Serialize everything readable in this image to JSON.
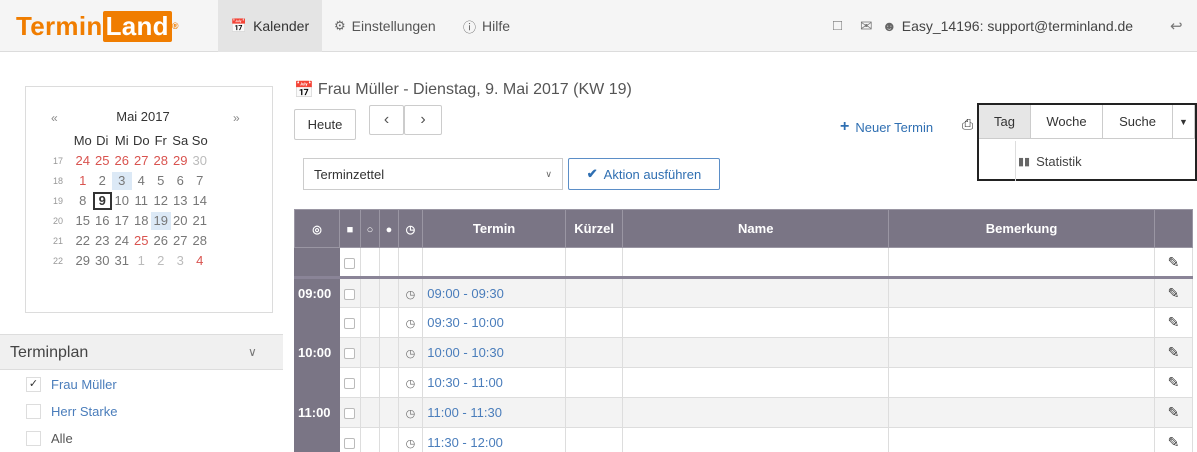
{
  "app": {
    "logo_text_a": "Termin",
    "logo_text_b": "Land",
    "logo_reg": "®"
  },
  "nav": {
    "kalender": "Kalender",
    "einstellungen": "Einstellungen",
    "hilfe": "Hilfe"
  },
  "user": {
    "account": "Easy_14196: support@terminland.de"
  },
  "mini_calendar": {
    "prev": "«",
    "next": "»",
    "month": "Mai 2017",
    "weekdays": [
      "Mo",
      "Di",
      "Mi",
      "Do",
      "Fr",
      "Sa",
      "So"
    ],
    "weeks": [
      {
        "kw": "17",
        "days": [
          "24",
          "25",
          "26",
          "27",
          "28",
          "29",
          "30"
        ]
      },
      {
        "kw": "18",
        "days": [
          "1",
          "2",
          "3",
          "4",
          "5",
          "6",
          "7"
        ]
      },
      {
        "kw": "19",
        "days": [
          "8",
          "9",
          "10",
          "11",
          "12",
          "13",
          "14"
        ]
      },
      {
        "kw": "20",
        "days": [
          "15",
          "16",
          "17",
          "18",
          "19",
          "20",
          "21"
        ]
      },
      {
        "kw": "21",
        "days": [
          "22",
          "23",
          "24",
          "25",
          "26",
          "27",
          "28"
        ]
      },
      {
        "kw": "22",
        "days": [
          "29",
          "30",
          "31",
          "1",
          "2",
          "3",
          "4"
        ]
      }
    ]
  },
  "terminplan": {
    "title": "Terminplan",
    "items": [
      {
        "label": "Frau Müller",
        "checked": "✓"
      },
      {
        "label": "Herr Starke",
        "checked": ""
      },
      {
        "label": "Alle",
        "checked": ""
      }
    ]
  },
  "main": {
    "title": "Frau Müller - Dienstag, 9. Mai 2017 (KW 19)",
    "today_button": "Heute",
    "prev_button": "‹",
    "next_button": "›",
    "new_appointment": "Neuer Termin",
    "views": {
      "tag": "Tag",
      "woche": "Woche",
      "suche": "Suche",
      "statistik": "Statistik"
    },
    "action_select": "Terminzettel",
    "action_button": "Aktion ausführen"
  },
  "table": {
    "headers": {
      "termin": "Termin",
      "kuerzel": "Kürzel",
      "name": "Name",
      "bemerkung": "Bemerkung"
    },
    "rows": [
      {
        "hour": "",
        "time": ""
      },
      {
        "hour": "09:00",
        "time": "09:00 - 09:30"
      },
      {
        "hour": "",
        "time": "09:30 - 10:00"
      },
      {
        "hour": "10:00",
        "time": "10:00 - 10:30"
      },
      {
        "hour": "",
        "time": "10:30 - 11:00"
      },
      {
        "hour": "11:00",
        "time": "11:00 - 11:30"
      },
      {
        "hour": "",
        "time": "11:30 - 12:00"
      }
    ]
  }
}
